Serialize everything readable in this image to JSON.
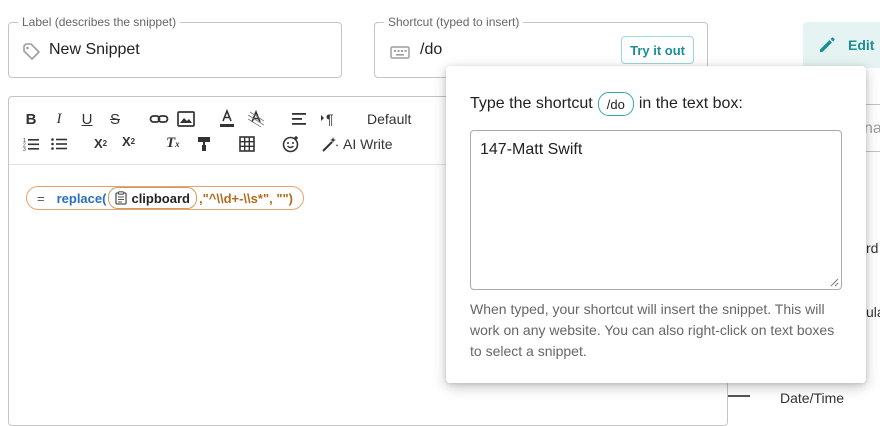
{
  "label_field": {
    "legend": "Label (describes the snippet)",
    "value": "New Snippet",
    "icon": "tag-icon"
  },
  "shortcut_field": {
    "legend": "Shortcut (typed to insert)",
    "value": "/do",
    "icon": "keyboard-icon",
    "try_button": "Try it out"
  },
  "side_tab": {
    "label": "Edit",
    "icon": "pencil-icon"
  },
  "right_panel": {
    "frag1": "na",
    "frag2": "rd",
    "frag3": "ula",
    "datetime_label": "Date/Time"
  },
  "toolbar": {
    "row1": [
      "bold",
      "italic",
      "underline",
      "strikethrough",
      "link",
      "image",
      "text-color",
      "highlight",
      "align",
      "paragraph-direction"
    ],
    "font_size": "Default",
    "row2": [
      "numbered-list",
      "bulleted-list",
      "subscript",
      "superscript",
      "clear-format",
      "format-painter",
      "table",
      "emoji"
    ],
    "ai_write": "AI Write"
  },
  "formula": {
    "equals": "=",
    "function": "replace(",
    "chip": "clipboard",
    "args": ",\"^\\\\d+-\\\\s*\", \"\")"
  },
  "popover": {
    "title_pre": "Type the shortcut",
    "title_chip": "/do",
    "title_post": "in the text box:",
    "textarea_value": "147-Matt Swift",
    "help": "When typed, your shortcut will insert the snippet. This will work on any website. You can also right-click on text boxes to select a snippet."
  },
  "colors": {
    "accent": "#1c8f93",
    "formula_border": "#e8a36a",
    "function_blue": "#2a6fb8"
  }
}
